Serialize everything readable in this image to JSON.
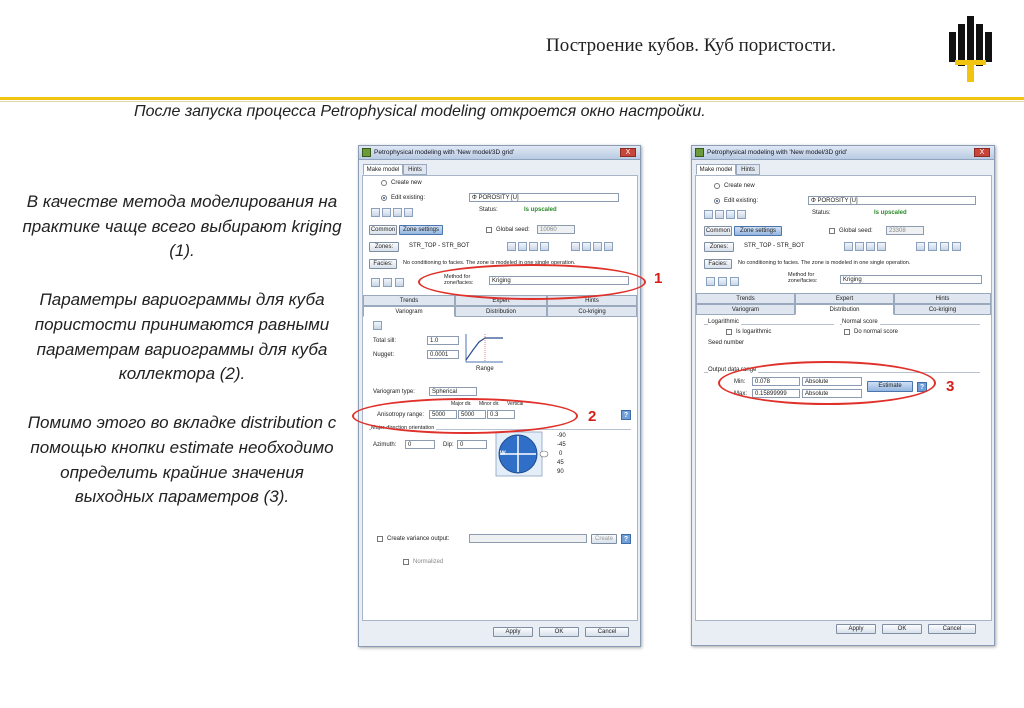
{
  "slide": {
    "title": "Построение кубов. Куб пористости.",
    "subtitle": "После запуска процесса Petrophysical modeling откроется окно настройки.",
    "description": [
      "В качестве метода моделирования на практике чаще всего выбирают kriging (1).",
      "Параметры вариограммы для куба пористости принимаются равными параметрам вариограммы для куба коллектора (2).",
      "Помимо этого во вкладке distribution с помощью кнопки estimate необходимо определить крайние значения выходных параметров (3)."
    ],
    "accent_color": "#f1c40f",
    "highlight_color": "#e0302a"
  },
  "dialog": {
    "title": "Petrophysical modeling with 'New model/3D grid'",
    "close_label": "X",
    "top_tabs": [
      "Make model",
      "Hints"
    ],
    "create_new": "Create new",
    "edit_existing": "Edit existing:",
    "property": "Φ  POROSITY [U]",
    "status_label": "Status:",
    "status_value": "Is upscaled",
    "common_button": "Common",
    "zone_settings_button": "Zone settings",
    "global_seed_label": "Global seed:",
    "seed_left": "10060",
    "seed_right": "23308",
    "zones_label": "Zones:",
    "zones_value": "STR_TOP - STR_BOT",
    "facies_label": "Facies:",
    "facies_note": "No conditioning to facies. The zone is modeled in one single operation.",
    "method_label": "Method for zone/facies:",
    "method_value": "Kriging",
    "method_tabs": [
      "Trends",
      "Expert",
      "Hints"
    ],
    "sub_tabs": [
      "Variogram",
      "Distribution",
      "Co-kriging"
    ],
    "help_glyph": "?",
    "variogram": {
      "total_sill_label": "Total sill:",
      "total_sill": "1.0",
      "nugget_label": "Nugget:",
      "nugget": "0.0001",
      "range_label": "Range",
      "type_label": "Variogram type:",
      "type_value": "Spherical",
      "major_label": "Major dir.",
      "minor_label": "Minor dir.",
      "vertical_label": "Vertical",
      "anisotropy_label": "Anisotropy range:",
      "major": "5000",
      "minor": "5000",
      "vertical": "0.3",
      "direction_label": "Major direction orientation",
      "azimuth_label": "Azimuth:",
      "azimuth": "0",
      "dip_label": "Dip:",
      "dip": "0",
      "dip_scale": [
        "-90",
        "-45",
        "0",
        "45",
        "90"
      ],
      "compass_letter": "W",
      "variance_label": "Create variance output:",
      "create_button": "Create",
      "normalized_label": "Normalized"
    },
    "distribution": {
      "logarithmic_label": "Logarithmic",
      "is_log_label": "Is logarithmic",
      "normal_score_label": "Normal score",
      "no_normal_label": "Do normal score",
      "seed_number_label": "Seed number",
      "output_range_label": "Output data range",
      "min_label": "Min:",
      "min_value": "0.078",
      "max_label": "Max:",
      "max_value": "0.15899999",
      "absolute": "Absolute",
      "estimate_button": "Estimate"
    },
    "footer": {
      "apply": "Apply",
      "ok": "OK",
      "cancel": "Cancel"
    }
  },
  "markers": [
    "1",
    "2",
    "3"
  ]
}
